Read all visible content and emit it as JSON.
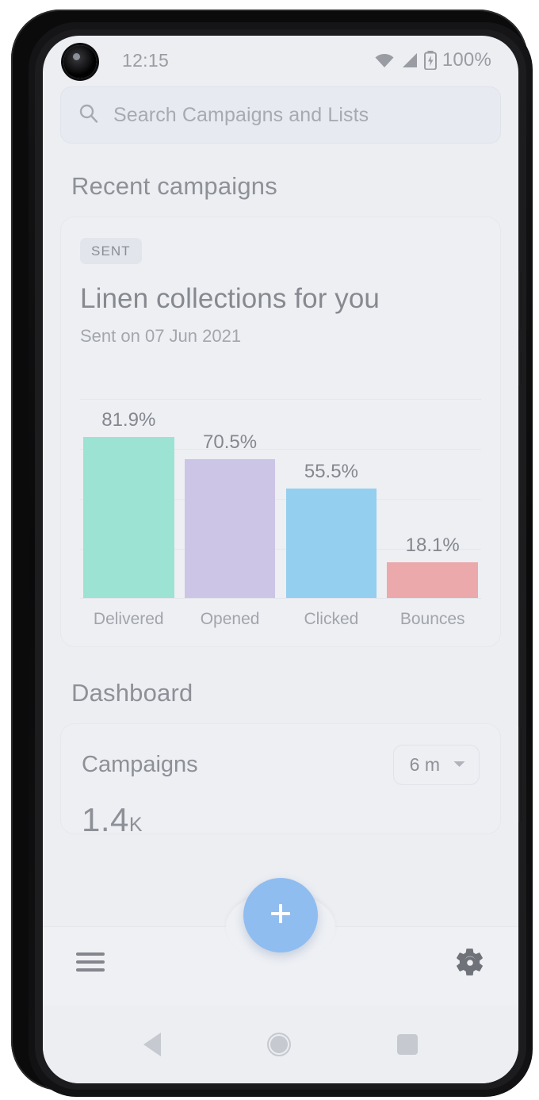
{
  "status_bar": {
    "time": "12:15",
    "battery_percent": "100%",
    "icons": [
      "wifi-icon",
      "signal-icon",
      "battery-charging-icon"
    ]
  },
  "search": {
    "placeholder": "Search Campaigns and Lists",
    "icon": "search-icon"
  },
  "recent_section": {
    "heading": "Recent campaigns",
    "card": {
      "badge": "SENT",
      "title": "Linen collections for you",
      "subtitle": "Sent on 07 Jun 2021"
    }
  },
  "chart_data": {
    "type": "bar",
    "title": "",
    "categories": [
      "Delivered",
      "Opened",
      "Clicked",
      "Bounces"
    ],
    "values": [
      81.9,
      70.5,
      55.5,
      18.1
    ],
    "value_labels": [
      "81.9%",
      "70.5%",
      "55.5%",
      "18.1%"
    ],
    "colors": [
      "#9ce3d4",
      "#ccc5e6",
      "#94cfef",
      "#eba9ac"
    ],
    "xlabel": "",
    "ylabel": "",
    "ylim": [
      0,
      100
    ],
    "grid": true,
    "legend": "none"
  },
  "dashboard_section": {
    "heading": "Dashboard",
    "card": {
      "label": "Campaigns",
      "range_value": "6 m",
      "range_icon": "chevron-down-icon",
      "stat_number": "1.4",
      "stat_suffix": "K"
    }
  },
  "bottom_bar": {
    "menu_icon": "hamburger-menu-icon",
    "fab_icon": "plus-icon",
    "settings_icon": "gear-icon",
    "fab_color": "#8fbdf0"
  },
  "nav_bar": {
    "back": "back-triangle-icon",
    "home": "home-circle-icon",
    "recents": "recents-square-icon"
  },
  "theme": {
    "screen_bg": "#eceef2",
    "card_bg": "#edeff3",
    "text_muted": "#8d9097"
  }
}
